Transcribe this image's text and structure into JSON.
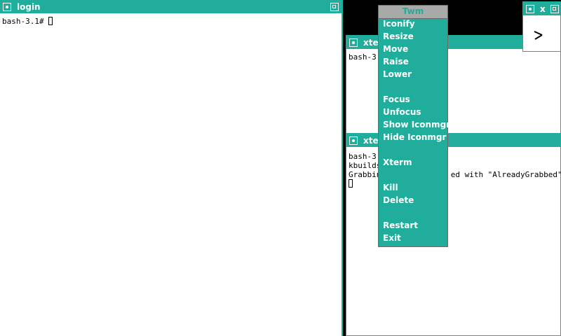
{
  "login_window": {
    "title": "login",
    "lines": [
      "bash-3.1# "
    ]
  },
  "xterm_top": {
    "title": "xte",
    "lines": [
      "bash-3."
    ]
  },
  "xterm_bottom": {
    "title": "xte",
    "line1": "bash-3.",
    "line2": "kbuilds",
    "line3_left": "Grabbin",
    "line3_right": "ed with \"AlreadyGrabbed\""
  },
  "clock_window": {
    "title": "x"
  },
  "twm_menu": {
    "title": "Twm",
    "items": [
      "Iconify",
      "Resize",
      "Move",
      "Raise",
      "Lower",
      "Focus",
      "Unfocus",
      "Show Iconmgr",
      "Hide Iconmgr",
      "Xterm",
      "Kill",
      "Delete",
      "Restart",
      "Exit"
    ]
  },
  "colors": {
    "titlebar": "#20ad9b",
    "menu_title_bg": "#a8aaa8",
    "desktop": "#000000"
  },
  "icons": [
    "window-menu-icon",
    "resize-icon",
    "clock-face-icon"
  ]
}
